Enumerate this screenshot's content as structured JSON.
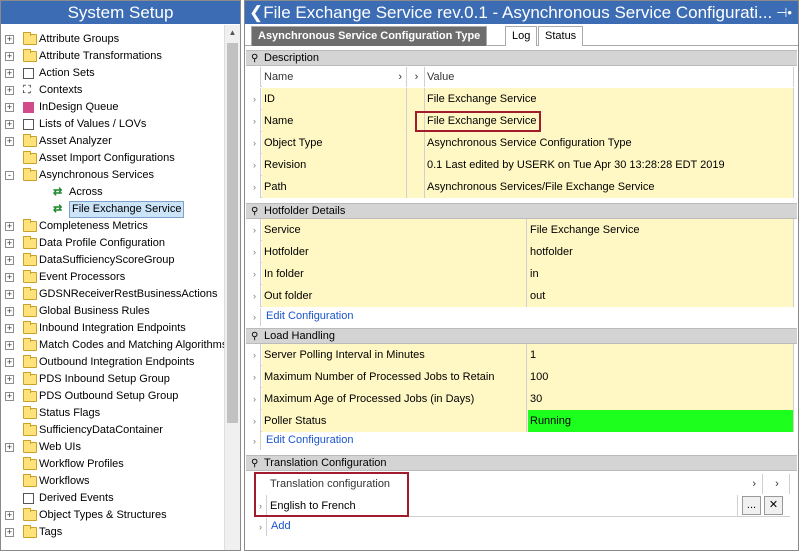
{
  "left": {
    "title": "System Setup",
    "tree": [
      {
        "label": "Attribute Groups",
        "icon": "folder-icon",
        "expander": "+"
      },
      {
        "label": "Attribute Transformations",
        "icon": "folder-icon",
        "expander": "+"
      },
      {
        "label": "Action Sets",
        "icon": "list-icon",
        "expander": "+"
      },
      {
        "label": "Contexts",
        "icon": "contexts-icon",
        "expander": "+"
      },
      {
        "label": "InDesign Queue",
        "icon": "indesign-icon",
        "expander": "+"
      },
      {
        "label": "Lists of Values / LOVs",
        "icon": "list-icon",
        "expander": "+"
      },
      {
        "label": "Asset Analyzer",
        "icon": "folder-icon",
        "expander": "+"
      },
      {
        "label": "Asset Import Configurations",
        "icon": "folder-icon",
        "expander": ""
      },
      {
        "label": "Asynchronous Services",
        "icon": "folder-icon",
        "expander": "-"
      },
      {
        "label": "Across",
        "icon": "service-icon",
        "expander": "",
        "indent": 1
      },
      {
        "label": "File Exchange Service",
        "icon": "service-icon",
        "expander": "",
        "indent": 1,
        "selected": true
      },
      {
        "label": "Completeness Metrics",
        "icon": "folder-icon",
        "expander": "+"
      },
      {
        "label": "Data Profile Configuration",
        "icon": "folder-icon",
        "expander": "+"
      },
      {
        "label": "DataSufficiencyScoreGroup",
        "icon": "folder-icon",
        "expander": "+"
      },
      {
        "label": "Event Processors",
        "icon": "folder-icon",
        "expander": "+"
      },
      {
        "label": "GDSNReceiverRestBusinessActions",
        "icon": "folder-icon",
        "expander": "+"
      },
      {
        "label": "Global Business Rules",
        "icon": "folder-icon",
        "expander": "+"
      },
      {
        "label": "Inbound Integration Endpoints",
        "icon": "folder-icon",
        "expander": "+"
      },
      {
        "label": "Match Codes and Matching Algorithms",
        "icon": "folder-icon",
        "expander": "+"
      },
      {
        "label": "Outbound Integration Endpoints",
        "icon": "folder-icon",
        "expander": "+"
      },
      {
        "label": "PDS Inbound Setup Group",
        "icon": "folder-icon",
        "expander": "+"
      },
      {
        "label": "PDS Outbound Setup Group",
        "icon": "folder-icon",
        "expander": "+"
      },
      {
        "label": "Status Flags",
        "icon": "folder-icon",
        "expander": ""
      },
      {
        "label": "SufficiencyDataContainer",
        "icon": "folder-icon",
        "expander": ""
      },
      {
        "label": "Web UIs",
        "icon": "folder-icon",
        "expander": "+"
      },
      {
        "label": "Workflow Profiles",
        "icon": "folder-icon",
        "expander": ""
      },
      {
        "label": "Workflows",
        "icon": "folder-icon",
        "expander": ""
      },
      {
        "label": "Derived Events",
        "icon": "list-icon",
        "expander": ""
      },
      {
        "label": "Object Types & Structures",
        "icon": "folder-icon",
        "expander": "+"
      },
      {
        "label": "Tags",
        "icon": "folder-icon",
        "expander": "+"
      }
    ]
  },
  "right": {
    "title": "File Exchange Service rev.0.1 - Asynchronous Service Configurati...",
    "pin_glyph": "⊣•",
    "tabs": [
      "Asynchronous Service Configuration Type",
      "Log",
      "Status"
    ],
    "description": {
      "header": "Description",
      "col_name": "Name",
      "col_value": "Value",
      "rows": [
        {
          "name": "ID",
          "value": "File Exchange Service"
        },
        {
          "name": "Name",
          "value": "File Exchange Service"
        },
        {
          "name": "Object Type",
          "value": "Asynchronous Service Configuration Type"
        },
        {
          "name": "Revision",
          "value": "0.1 Last edited by USERK on Tue Apr 30 13:28:28 EDT 2019"
        },
        {
          "name": "Path",
          "value": "Asynchronous Services/File Exchange Service"
        }
      ]
    },
    "hotfolder": {
      "header": "Hotfolder Details",
      "rows": [
        {
          "name": "Service",
          "value": "File Exchange Service"
        },
        {
          "name": "Hotfolder",
          "value": "hotfolder"
        },
        {
          "name": "In folder",
          "value": "in"
        },
        {
          "name": "Out folder",
          "value": "out"
        }
      ],
      "edit_link": "Edit Configuration"
    },
    "load": {
      "header": "Load Handling",
      "rows": [
        {
          "name": "Server Polling Interval in Minutes",
          "value": "1"
        },
        {
          "name": "Maximum Number of Processed Jobs to Retain",
          "value": "100"
        },
        {
          "name": "Maximum Age of Processed Jobs (in Days)",
          "value": "30"
        },
        {
          "name": "Poller Status",
          "value": "Running",
          "status_color": "#1dff1d"
        }
      ],
      "edit_link": "Edit Configuration"
    },
    "translation": {
      "header": "Translation Configuration",
      "col": "Translation configuration",
      "row": "English to French",
      "more_btn": "...",
      "add_link": "Add"
    }
  }
}
